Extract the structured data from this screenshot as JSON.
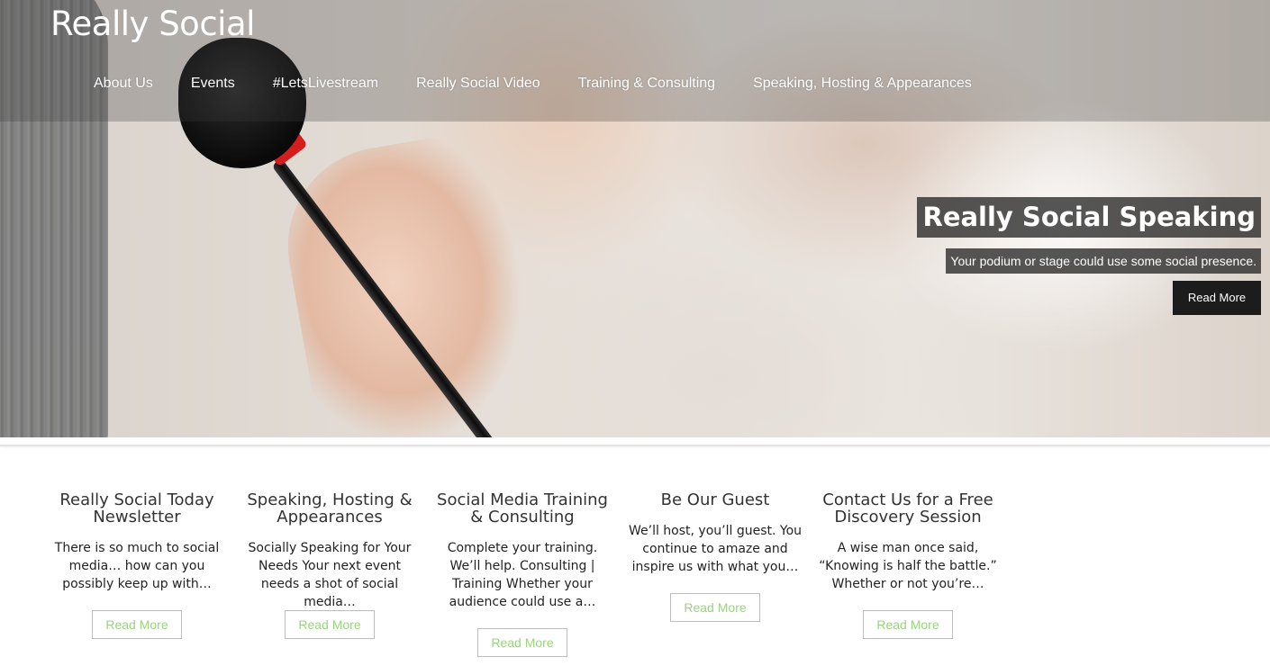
{
  "header": {
    "site_title": "Really Social",
    "nav": [
      "About Us",
      "Events",
      "#LetsLivestream",
      "Really Social Video",
      "Training & Consulting",
      "Speaking, Hosting & Appearances"
    ]
  },
  "hero": {
    "title": "Really Social Speaking",
    "subtitle": "Your podium or stage could use some social presence.",
    "button": "Read More"
  },
  "features": [
    {
      "title": "Really Social Today Newsletter",
      "text": "There is so much to social media… how can you possibly keep up with…",
      "button": "Read More"
    },
    {
      "title": "Speaking, Hosting & Appearances",
      "text": "Socially Speaking for Your Needs Your next event needs a shot of social media…",
      "button": "Read More"
    },
    {
      "title": "Social Media Training & Consulting",
      "text": "Complete your training. We’ll help. Consulting  |  Training Whether your audience could use a…",
      "button": "Read More"
    },
    {
      "title": "Be Our Guest",
      "text": "We’ll host, you’ll guest. You continue to amaze and inspire us with what you…",
      "button": "Read More"
    },
    {
      "title": "Contact Us for a Free Discovery Session",
      "text": "A wise man once said, “Knowing is half the battle.” Whether or not you’re…",
      "button": "Read More"
    }
  ],
  "colors": {
    "button_text": "#9bd37f",
    "overlay": "#282828"
  }
}
